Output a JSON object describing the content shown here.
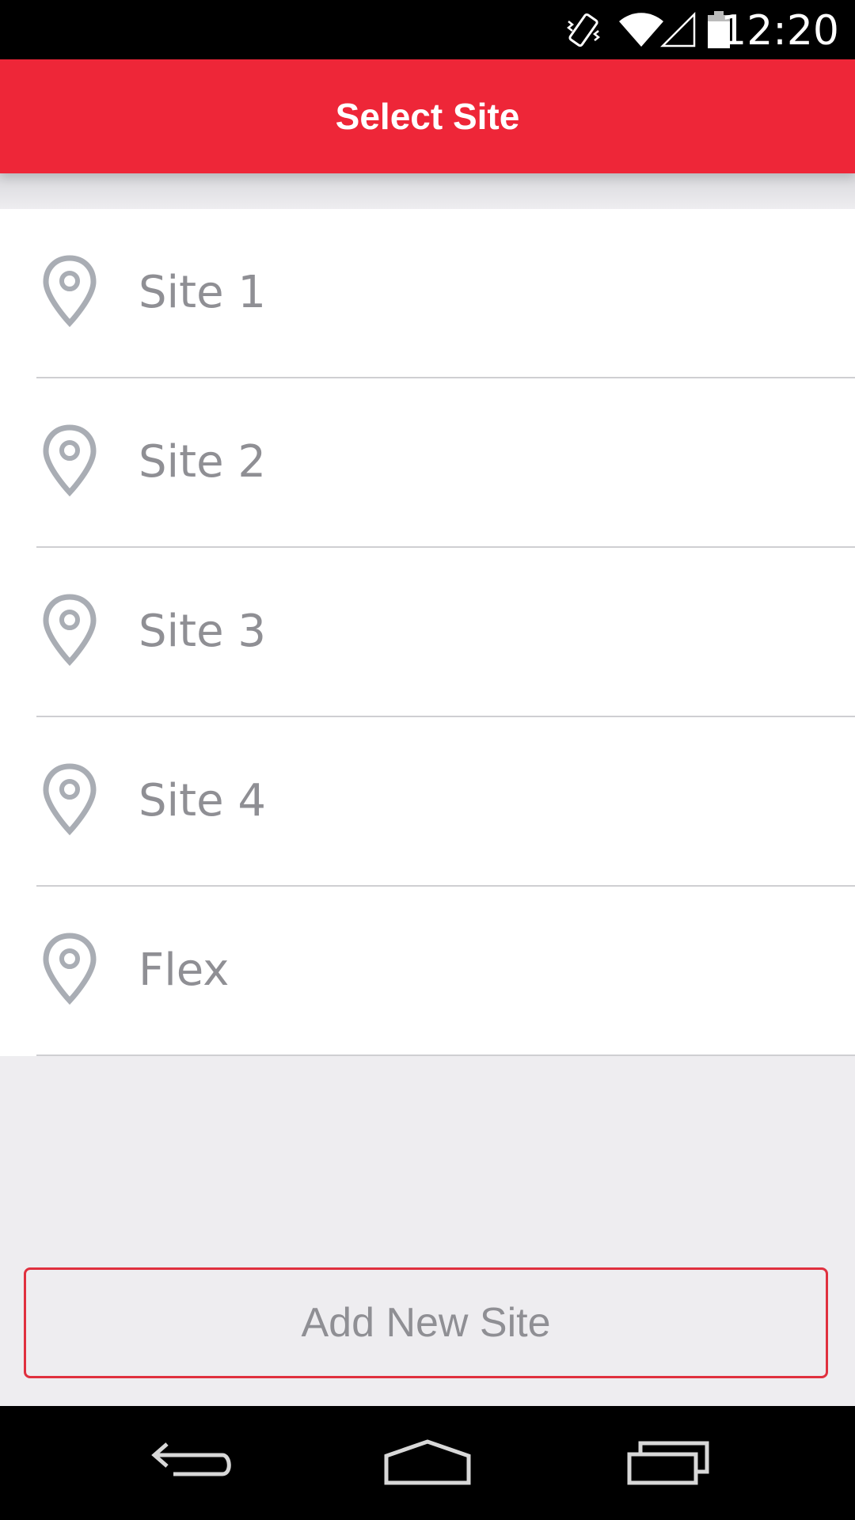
{
  "status_bar": {
    "time": "12:20",
    "icons": [
      "vibrate-icon",
      "wifi-icon",
      "signal-icon",
      "battery-icon"
    ]
  },
  "app_bar": {
    "title": "Select Site",
    "color": "#ee2638"
  },
  "sites": [
    {
      "label": "Site 1",
      "icon": "location-pin-icon"
    },
    {
      "label": "Site 2",
      "icon": "location-pin-icon"
    },
    {
      "label": "Site 3",
      "icon": "location-pin-icon"
    },
    {
      "label": "Site 4",
      "icon": "location-pin-icon"
    },
    {
      "label": "Flex",
      "icon": "location-pin-icon"
    }
  ],
  "add_button": {
    "label": "Add New Site",
    "border_color": "#e0303f"
  },
  "nav_bar": {
    "buttons": [
      "back-icon",
      "home-icon",
      "recents-icon"
    ]
  }
}
